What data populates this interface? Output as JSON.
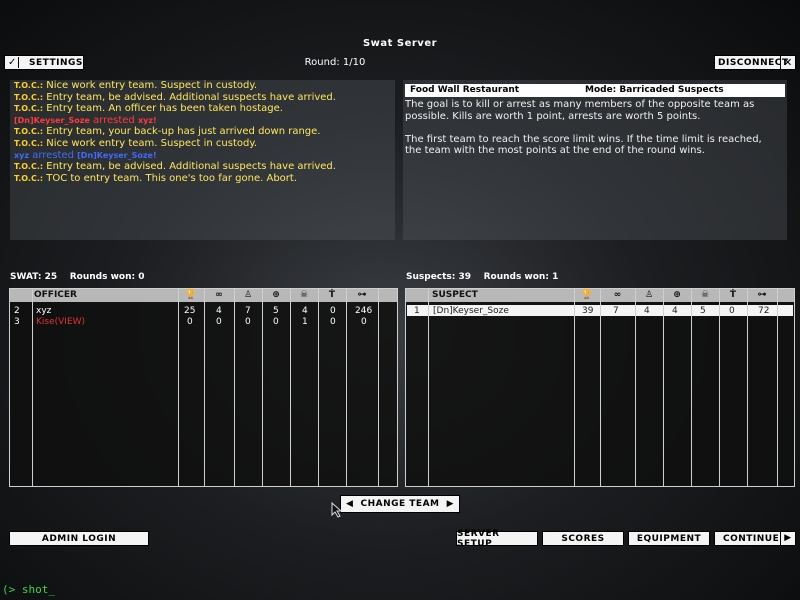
{
  "header": {
    "title": "Swat Server",
    "round": "Round: 1/10",
    "settings_label": "SETTINGS",
    "disconnect_label": "DISCONNECT"
  },
  "chat": {
    "lines": [
      {
        "speaker": "T.O.C.:",
        "text": "Nice work entry team.  Suspect in custody."
      },
      {
        "speaker": "T.O.C.:",
        "text": "Entry team, be advised.  Additional suspects have arrived."
      },
      {
        "speaker": "T.O.C.:",
        "text": "Entry team.  An officer has been taken hostage."
      },
      {
        "arrest_red": "[Dn]Keyser_Soze",
        "arrested": " arrested ",
        "target_red": "xyz!"
      },
      {
        "speaker": "T.O.C.:",
        "text": "Entry team, your back-up has just arrived down range."
      },
      {
        "speaker": "T.O.C.:",
        "text": "Nice work entry team.  Suspect in custody."
      },
      {
        "arrest_blue": "xyz",
        "arrested": " arrested ",
        "target_blue": "[Dn]Keyser_Soze!"
      },
      {
        "speaker": "T.O.C.:",
        "text": "Entry team, be advised.  Additional suspects have arrived."
      },
      {
        "speaker": "T.O.C.:",
        "text": "TOC to entry team.  This one's too far gone.  Abort."
      }
    ]
  },
  "info": {
    "map": "Food Wall Restaurant",
    "mode": "Mode: Barricaded Suspects",
    "paragraph1": "The goal is to kill or arrest as many members of the opposite team as possible.  Kills are worth 1 point, arrests are worth 5 points.",
    "paragraph2": "The first team to reach the score limit wins.  If the time limit is reached, the team with the most points at the end of the round wins."
  },
  "swat": {
    "summary": "SWAT: 25    Rounds won: 0",
    "header": "OFFICER",
    "rows": [
      {
        "num": "2",
        "name": "xyz",
        "score": "25",
        "c2": "4",
        "c3": "7",
        "c4": "5",
        "c5": "4",
        "c6": "0",
        "ping": "246"
      },
      {
        "num": "3",
        "name": "Kise(VIEW)",
        "score": "0",
        "c2": "0",
        "c3": "0",
        "c4": "0",
        "c5": "1",
        "c6": "0",
        "ping": "0"
      }
    ]
  },
  "suspects": {
    "summary": "Suspects: 39    Rounds won: 1",
    "header": "SUSPECT",
    "rows": [
      {
        "num": "1",
        "name": "[Dn]Keyser_Soze",
        "score": "39",
        "c2": "7",
        "c3": "4",
        "c4": "4",
        "c5": "5",
        "c6": "0",
        "ping": "72"
      }
    ]
  },
  "footer": {
    "change_team": "CHANGE TEAM",
    "admin_login": "ADMIN LOGIN",
    "server_setup": "SERVER SETUP",
    "scores": "SCORES",
    "equipment": "EQUIPMENT",
    "continue": "CONTINUE"
  },
  "console": "(> shot_",
  "colors": {
    "toc": "#ffd21e",
    "red_team": "#ff3a3a",
    "blue_team": "#3c6cff",
    "console": "#3cd64a"
  }
}
